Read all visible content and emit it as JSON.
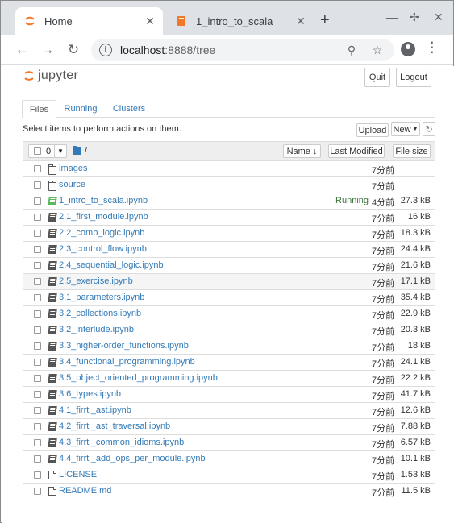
{
  "browser": {
    "tabs": [
      {
        "title": "Home",
        "close": "✕"
      },
      {
        "title": "1_intro_to_scala",
        "close": "✕"
      }
    ],
    "new_tab": "+",
    "window_controls": {
      "minimize": "—",
      "maximize": "✢",
      "close": "✕"
    },
    "url_host": "localhost",
    "url_rest": ":8888/tree",
    "icons": [
      "back-icon",
      "forward-icon",
      "reload-icon",
      "info-icon",
      "zoom-out-icon",
      "star-icon",
      "profile-icon",
      "menu-icon"
    ]
  },
  "header": {
    "logo_text": "jupyter",
    "quit_label": "Quit",
    "logout_label": "Logout"
  },
  "tabs": {
    "files": "Files",
    "running": "Running",
    "clusters": "Clusters"
  },
  "toolbar": {
    "select_note": "Select items to perform actions on them.",
    "upload_label": "Upload",
    "new_label": "New",
    "refresh_icon": "refresh-icon"
  },
  "list_header": {
    "selected_count": "0",
    "breadcrumb": "/",
    "name_label": "Name",
    "last_modified_label": "Last Modified",
    "file_size_label": "File size"
  },
  "files": [
    {
      "type": "folder",
      "name": "images",
      "modified": "7分前",
      "size": "",
      "status": ""
    },
    {
      "type": "folder",
      "name": "source",
      "modified": "7分前",
      "size": "",
      "status": ""
    },
    {
      "type": "notebook-running",
      "name": "1_intro_to_scala.ipynb",
      "modified": "4分前",
      "size": "27.3 kB",
      "status": "Running"
    },
    {
      "type": "notebook",
      "name": "2.1_first_module.ipynb",
      "modified": "7分前",
      "size": "16 kB",
      "status": ""
    },
    {
      "type": "notebook",
      "name": "2.2_comb_logic.ipynb",
      "modified": "7分前",
      "size": "18.3 kB",
      "status": ""
    },
    {
      "type": "notebook",
      "name": "2.3_control_flow.ipynb",
      "modified": "7分前",
      "size": "24.4 kB",
      "status": ""
    },
    {
      "type": "notebook",
      "name": "2.4_sequential_logic.ipynb",
      "modified": "7分前",
      "size": "21.6 kB",
      "status": ""
    },
    {
      "type": "notebook",
      "name": "2.5_exercise.ipynb",
      "modified": "7分前",
      "size": "17.1 kB",
      "status": ""
    },
    {
      "type": "notebook",
      "name": "3.1_parameters.ipynb",
      "modified": "7分前",
      "size": "35.4 kB",
      "status": ""
    },
    {
      "type": "notebook",
      "name": "3.2_collections.ipynb",
      "modified": "7分前",
      "size": "22.9 kB",
      "status": ""
    },
    {
      "type": "notebook",
      "name": "3.2_interlude.ipynb",
      "modified": "7分前",
      "size": "20.3 kB",
      "status": ""
    },
    {
      "type": "notebook",
      "name": "3.3_higher-order_functions.ipynb",
      "modified": "7分前",
      "size": "18 kB",
      "status": ""
    },
    {
      "type": "notebook",
      "name": "3.4_functional_programming.ipynb",
      "modified": "7分前",
      "size": "24.1 kB",
      "status": ""
    },
    {
      "type": "notebook",
      "name": "3.5_object_oriented_programming.ipynb",
      "modified": "7分前",
      "size": "22.2 kB",
      "status": ""
    },
    {
      "type": "notebook",
      "name": "3.6_types.ipynb",
      "modified": "7分前",
      "size": "41.7 kB",
      "status": ""
    },
    {
      "type": "notebook",
      "name": "4.1_firrtl_ast.ipynb",
      "modified": "7分前",
      "size": "12.6 kB",
      "status": ""
    },
    {
      "type": "notebook",
      "name": "4.2_firrtl_ast_traversal.ipynb",
      "modified": "7分前",
      "size": "7.88 kB",
      "status": ""
    },
    {
      "type": "notebook",
      "name": "4.3_firrtl_common_idioms.ipynb",
      "modified": "7分前",
      "size": "6.57 kB",
      "status": ""
    },
    {
      "type": "notebook",
      "name": "4.4_firrtl_add_ops_per_module.ipynb",
      "modified": "7分前",
      "size": "10.1 kB",
      "status": ""
    },
    {
      "type": "file",
      "name": "LICENSE",
      "modified": "7分前",
      "size": "1.53 kB",
      "status": ""
    },
    {
      "type": "file",
      "name": "README.md",
      "modified": "7分前",
      "size": "11.5 kB",
      "status": ""
    }
  ],
  "colors": {
    "link": "#337ab7",
    "running": "#3c763d",
    "jupyter_orange": "#f37726",
    "chrome_tabbar": "#dee1e6"
  }
}
